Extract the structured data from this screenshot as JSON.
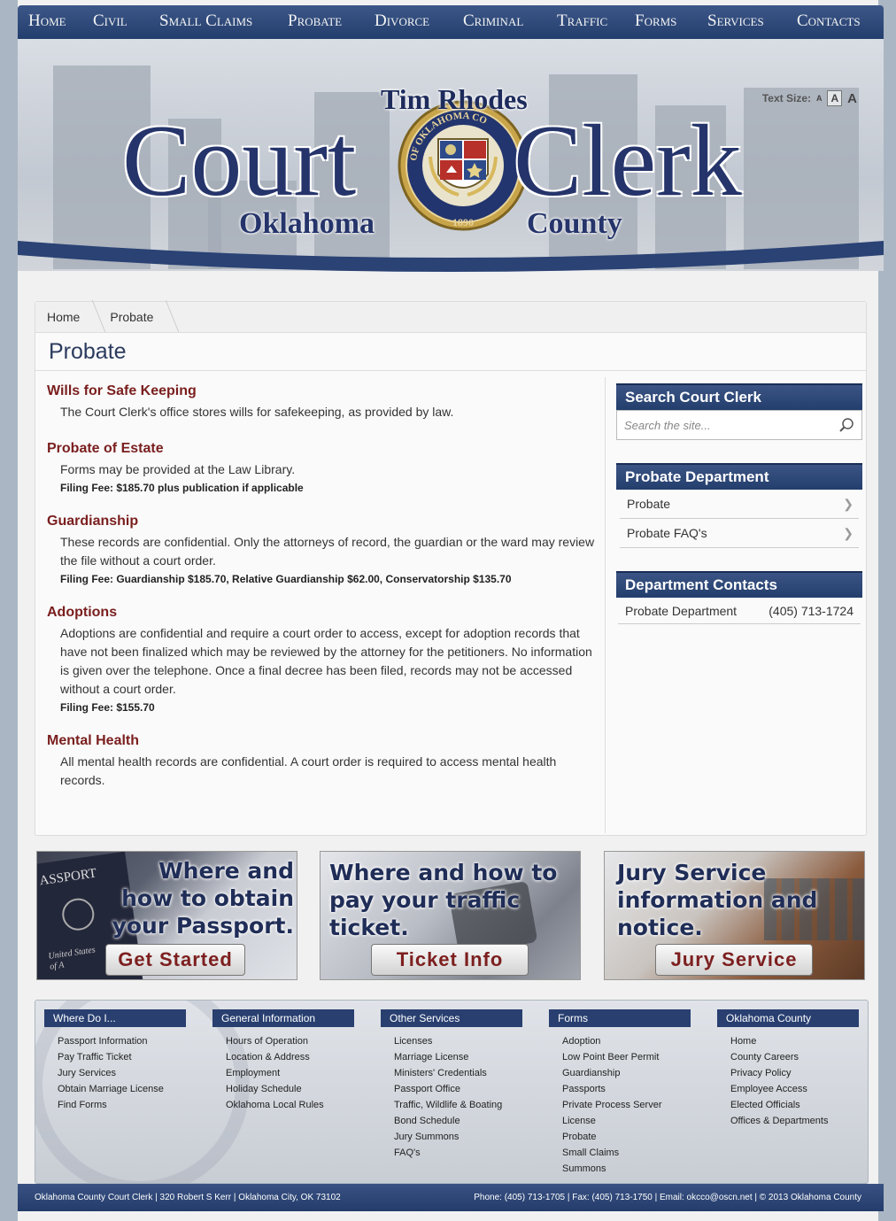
{
  "nav": [
    "Home",
    "Civil",
    "Small Claims",
    "Probate",
    "Divorce",
    "Criminal",
    "Traffic",
    "Forms",
    "Services",
    "Contacts"
  ],
  "header": {
    "name": "Tim Rhodes",
    "title_left": "Court",
    "title_right": "Clerk",
    "sub_left": "Oklahoma",
    "sub_right": "County",
    "seal_text": "OF OKLAHOMA CO",
    "seal_year": "1890",
    "text_size_label": "Text Size:",
    "text_sizes": [
      "A",
      "A",
      "A"
    ]
  },
  "breadcrumb": [
    "Home",
    "Probate"
  ],
  "page_title": "Probate",
  "sections": [
    {
      "title": "Wills for Safe Keeping",
      "body": "The Court Clerk's office stores wills for safekeeping, as provided by law.",
      "fee": ""
    },
    {
      "title": "Probate of Estate",
      "body": "Forms may be provided at the Law Library.",
      "fee": "Filing Fee: $185.70 plus publication if applicable"
    },
    {
      "title": "Guardianship",
      "body": "These records are confidential. Only the attorneys of record, the guardian or the ward may review the file without a court order.",
      "fee": "Filing Fee: Guardianship $185.70, Relative Guardianship $62.00, Conservatorship $135.70"
    },
    {
      "title": "Adoptions",
      "body": "Adoptions are confidential and require a court order to access, except for adoption records that have not been finalized which may be reviewed by the attorney for the petitioners. No information is given over the telephone. Once a final decree has been filed, records may not be accessed without a court order.",
      "fee": "Filing Fee: $155.70"
    },
    {
      "title": "Mental Health",
      "body": "All mental health records are confidential. A court order is required to access mental health records.",
      "fee": ""
    }
  ],
  "sidebar": {
    "search_title": "Search Court Clerk",
    "search_placeholder": "Search the site...",
    "dept_title": "Probate Department",
    "dept_links": [
      "Probate",
      "Probate FAQ's"
    ],
    "contacts_title": "Department Contacts",
    "contact_name": "Probate Department",
    "contact_phone": "(405) 713-1724"
  },
  "promos": [
    {
      "text": "Where and how to obtain your Passport.",
      "button": "Get Started",
      "image_text": "ASSPORT",
      "image_sub": "United States of A"
    },
    {
      "text": "Where and how to pay your traffic ticket.",
      "button": "Ticket Info"
    },
    {
      "text": "Jury Service information and notice.",
      "button": "Jury Service"
    }
  ],
  "footer_cols": [
    {
      "title": "Where Do I...",
      "items": [
        "Passport Information",
        "Pay Traffic Ticket",
        "Jury Services",
        "Obtain Marriage License",
        "Find Forms"
      ]
    },
    {
      "title": "General Information",
      "items": [
        "Hours of Operation",
        "Location & Address",
        "Employment",
        "Holiday Schedule",
        "Oklahoma Local Rules"
      ]
    },
    {
      "title": "Other Services",
      "items": [
        "Licenses",
        "Marriage License",
        "Ministers' Credentials",
        "Passport Office",
        "Traffic, Wildlife & Boating",
        "Bond Schedule",
        "Jury Summons",
        "FAQ's"
      ]
    },
    {
      "title": "Forms",
      "items": [
        "Adoption",
        "Low Point Beer Permit",
        "Guardianship",
        "Passports",
        "Private Process Server",
        "License",
        "Probate",
        "Small Claims",
        "Summons"
      ]
    },
    {
      "title": "Oklahoma County",
      "items": [
        "Home",
        "County Careers",
        "Privacy Policy",
        "Employee Access",
        "Elected Officials",
        "Offices & Departments"
      ]
    }
  ],
  "footer": {
    "left": "Oklahoma County Court Clerk | 320 Robert S Kerr | Oklahoma City, OK 73102",
    "right": "Phone: (405) 713-1705 | Fax: (405) 713-1750 | Email: okcco@oscn.net | © 2013 Oklahoma County"
  }
}
